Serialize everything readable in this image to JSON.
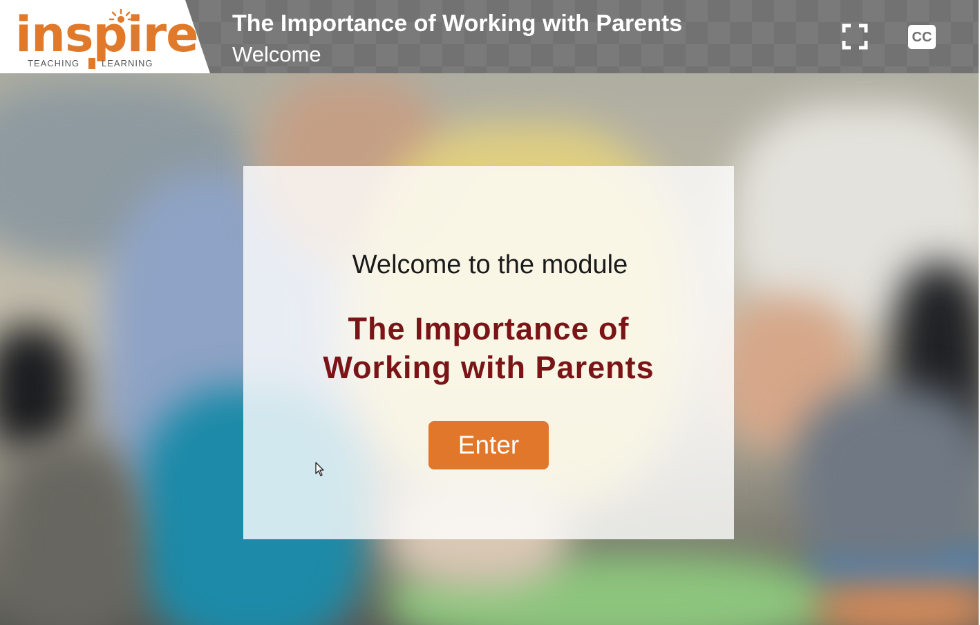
{
  "header": {
    "logo": {
      "word": "inspire",
      "tagline_left": "TEACHING",
      "tagline_right": "LEARNING",
      "icon": "sun-icon"
    },
    "title": "The Importance of Working with Parents",
    "subtitle": "Welcome",
    "controls": {
      "fullscreen_icon": "fullscreen-icon",
      "cc_label": "CC"
    }
  },
  "main": {
    "welcome_text": "Welcome to the module",
    "module_title_line1": "The Importance of",
    "module_title_line2": "Working with Parents",
    "enter_label": "Enter"
  },
  "colors": {
    "accent": "#e1772a",
    "title_red": "#7b1416",
    "header_bg": "#727272"
  }
}
